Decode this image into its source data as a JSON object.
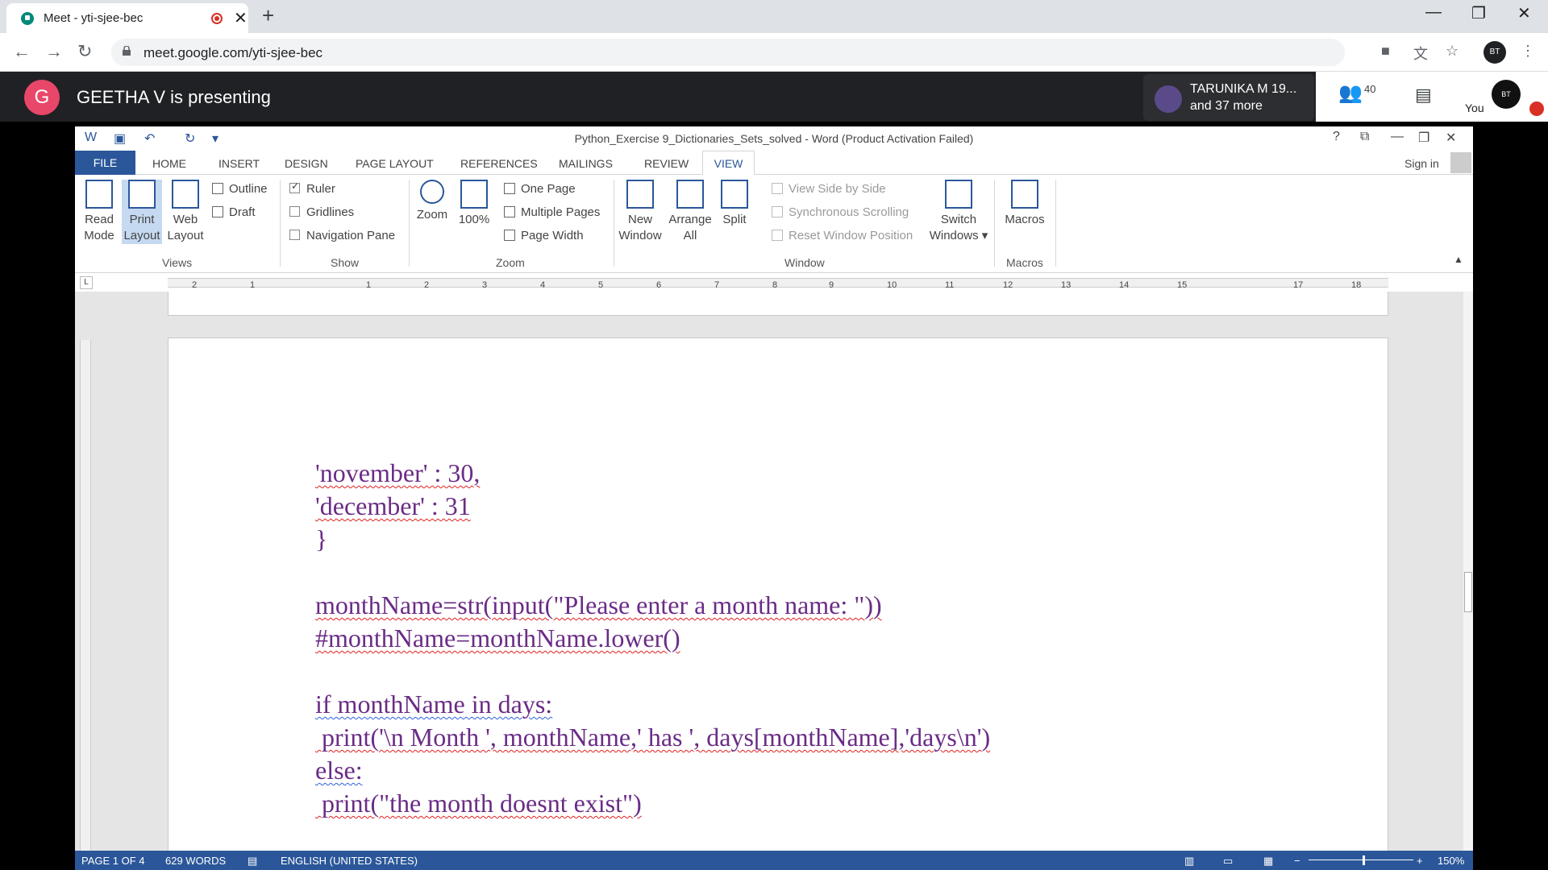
{
  "browser": {
    "tab_title": "Meet - yti-sjee-bec",
    "url": "meet.google.com/yti-sjee-bec",
    "profile_initials": "BT"
  },
  "meet": {
    "presenter_initial": "G",
    "presenting_text": "GEETHA V is presenting",
    "participant_name": "TARUNIKA M 19...",
    "participant_more": "and 37 more",
    "people_count": "40",
    "you_label": "You",
    "you_avatar_text": "BT"
  },
  "word": {
    "title": "Python_Exercise 9_Dictionaries_Sets_solved - Word (Product Activation Failed)",
    "tabs": [
      "FILE",
      "HOME",
      "INSERT",
      "DESIGN",
      "PAGE LAYOUT",
      "REFERENCES",
      "MAILINGS",
      "REVIEW",
      "VIEW"
    ],
    "sign_in": "Sign in",
    "ribbon": {
      "views": {
        "group": "Views",
        "read_mode": [
          "Read",
          "Mode"
        ],
        "print_layout": [
          "Print",
          "Layout"
        ],
        "web_layout": [
          "Web",
          "Layout"
        ],
        "outline": "Outline",
        "draft": "Draft"
      },
      "show": {
        "group": "Show",
        "ruler": "Ruler",
        "gridlines": "Gridlines",
        "navigation_pane": "Navigation Pane",
        "ruler_checked": true,
        "gridlines_checked": false,
        "navigation_checked": false
      },
      "zoom": {
        "group": "Zoom",
        "zoom": "Zoom",
        "hundred": "100%",
        "one_page": "One Page",
        "multiple_pages": "Multiple Pages",
        "page_width": "Page Width"
      },
      "window": {
        "group": "Window",
        "new_window": [
          "New",
          "Window"
        ],
        "arrange_all": [
          "Arrange",
          "All"
        ],
        "split": "Split",
        "side_by_side": "View Side by Side",
        "sync_scroll": "Synchronous Scrolling",
        "reset_position": "Reset Window Position",
        "switch_windows": [
          "Switch",
          "Windows ▾"
        ]
      },
      "macros": {
        "group": "Macros",
        "macros": "Macros"
      }
    },
    "ruler_numbers": [
      "2",
      "1",
      "1",
      "2",
      "3",
      "4",
      "5",
      "6",
      "7",
      "8",
      "9",
      "10",
      "11",
      "12",
      "13",
      "14",
      "15",
      "17",
      "18"
    ],
    "document_lines": [
      "'november' : 30,",
      "'december' : 31",
      "}",
      "",
      "monthName=str(input(\"Please enter a month name: \"))",
      "#monthName=monthName.lower()",
      "",
      "if monthName in days:",
      " print('\\n Month ', monthName,' has ', days[monthName],'days\\n')",
      "else:",
      " print(\"the month doesnt exist\")"
    ],
    "status": {
      "page": "PAGE 1 OF 4",
      "words": "629 WORDS",
      "language": "ENGLISH (UNITED STATES)",
      "zoom": "150%"
    }
  }
}
